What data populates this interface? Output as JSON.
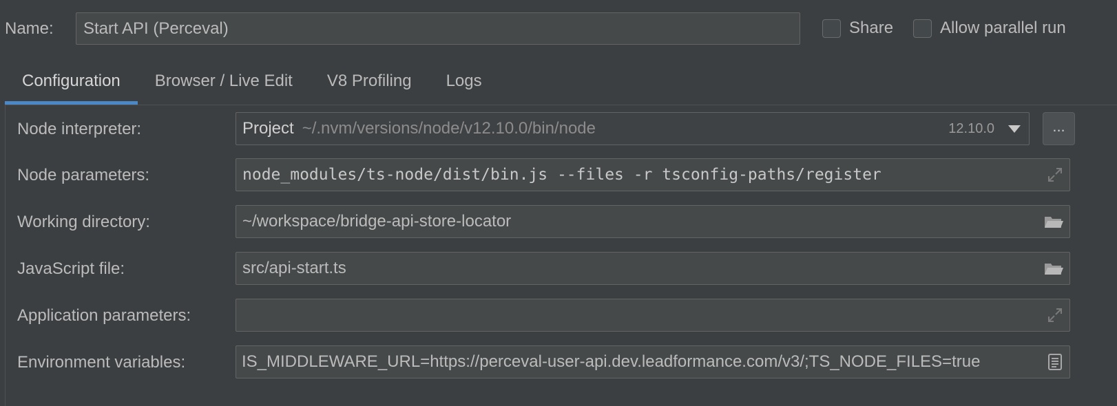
{
  "name_row": {
    "label": "Name:",
    "value": "Start API (Perceval)",
    "share_label": "Share",
    "share_checked": false,
    "parallel_label": "Allow parallel run",
    "parallel_checked": false
  },
  "tabs": [
    {
      "label": "Configuration",
      "active": true
    },
    {
      "label": "Browser / Live Edit",
      "active": false
    },
    {
      "label": "V8 Profiling",
      "active": false
    },
    {
      "label": "Logs",
      "active": false
    }
  ],
  "config": {
    "node_interpreter": {
      "label": "Node interpreter:",
      "kind": "Project",
      "path": "~/.nvm/versions/node/v12.10.0/bin/node",
      "version": "12.10.0",
      "browse_label": "..."
    },
    "node_parameters": {
      "label": "Node parameters:",
      "value": "node_modules/ts-node/dist/bin.js --files -r tsconfig-paths/register"
    },
    "working_directory": {
      "label": "Working directory:",
      "value": "~/workspace/bridge-api-store-locator"
    },
    "javascript_file": {
      "label": "JavaScript file:",
      "value": "src/api-start.ts"
    },
    "application_parameters": {
      "label": "Application parameters:",
      "value": ""
    },
    "environment_variables": {
      "label": "Environment variables:",
      "value": "IS_MIDDLEWARE_URL=https://perceval-user-api.dev.leadformance.com/v3/;TS_NODE_FILES=true"
    }
  },
  "colors": {
    "background": "#3c3f41",
    "field_bg": "#45494a",
    "accent": "#4a88c7",
    "text": "#bbbbbb"
  },
  "icons": {
    "expand": "expand-icon",
    "folder": "folder-icon",
    "document": "document-icon",
    "dropdown": "chevron-down-icon"
  }
}
